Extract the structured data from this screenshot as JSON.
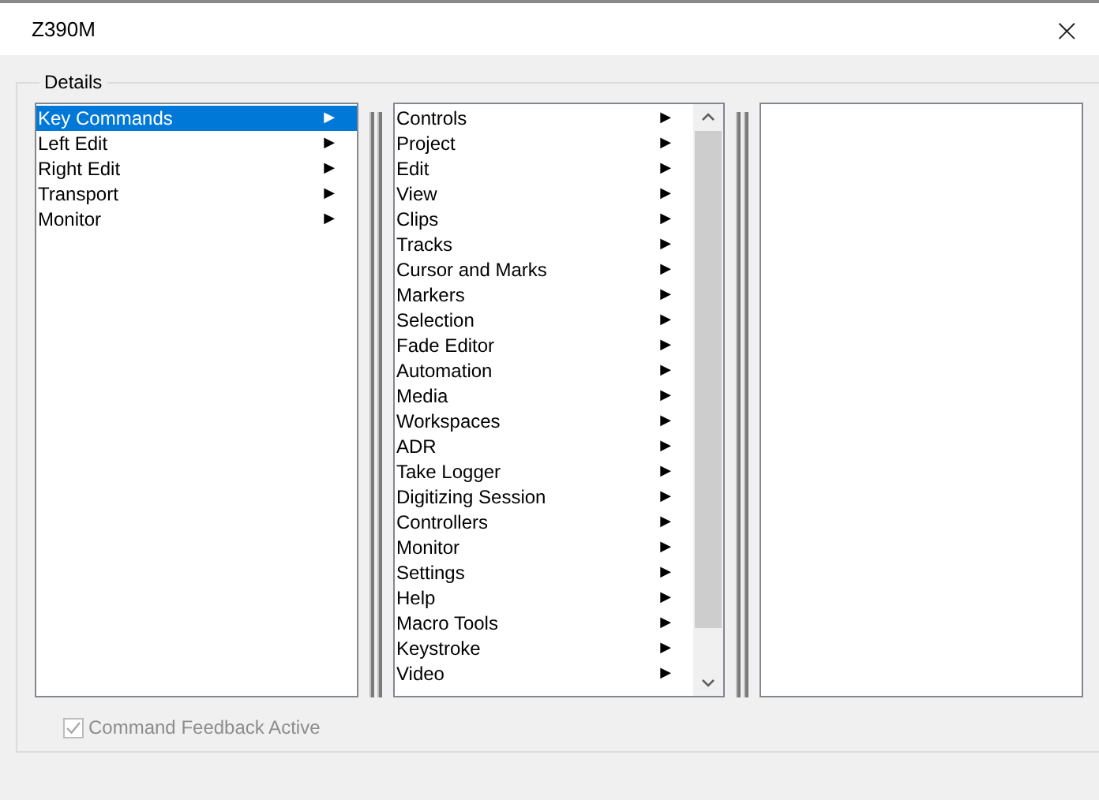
{
  "window": {
    "title": "Z390M",
    "close": "×"
  },
  "details": {
    "legend": "Details",
    "categories": [
      {
        "label": "Key Commands",
        "selected": true,
        "arrow": "▶"
      },
      {
        "label": "Left Edit",
        "selected": false,
        "arrow": "▶"
      },
      {
        "label": "Right Edit",
        "selected": false,
        "arrow": "▶"
      },
      {
        "label": "Transport",
        "selected": false,
        "arrow": "▶"
      },
      {
        "label": "Monitor",
        "selected": false,
        "arrow": "▶"
      }
    ],
    "commands": [
      {
        "label": "Controls",
        "selected": false,
        "arrow": "▶"
      },
      {
        "label": "Project",
        "selected": false,
        "arrow": "▶"
      },
      {
        "label": "Edit",
        "selected": false,
        "arrow": "▶"
      },
      {
        "label": "View",
        "selected": false,
        "arrow": "▶"
      },
      {
        "label": "Clips",
        "selected": false,
        "arrow": "▶"
      },
      {
        "label": "Tracks",
        "selected": false,
        "arrow": "▶"
      },
      {
        "label": "Cursor and Marks",
        "selected": false,
        "arrow": "▶"
      },
      {
        "label": "Markers",
        "selected": false,
        "arrow": "▶"
      },
      {
        "label": "Selection",
        "selected": false,
        "arrow": "▶"
      },
      {
        "label": "Fade Editor",
        "selected": false,
        "arrow": "▶"
      },
      {
        "label": "Automation",
        "selected": false,
        "arrow": "▶"
      },
      {
        "label": "Media",
        "selected": false,
        "arrow": "▶"
      },
      {
        "label": "Workspaces",
        "selected": false,
        "arrow": "▶"
      },
      {
        "label": "ADR",
        "selected": false,
        "arrow": "▶"
      },
      {
        "label": "Take Logger",
        "selected": false,
        "arrow": "▶"
      },
      {
        "label": "Digitizing Session",
        "selected": false,
        "arrow": "▶"
      },
      {
        "label": "Controllers",
        "selected": false,
        "arrow": "▶"
      },
      {
        "label": "Monitor",
        "selected": false,
        "arrow": "▶"
      },
      {
        "label": "Settings",
        "selected": false,
        "arrow": "▶"
      },
      {
        "label": "Help",
        "selected": false,
        "arrow": "▶"
      },
      {
        "label": "Macro Tools",
        "selected": false,
        "arrow": "▶"
      },
      {
        "label": "Keystroke",
        "selected": false,
        "arrow": "▶"
      },
      {
        "label": "Video",
        "selected": false,
        "arrow": "▶"
      }
    ]
  },
  "feedback": {
    "label": "Command Feedback Active",
    "checked": true,
    "disabled": true
  }
}
